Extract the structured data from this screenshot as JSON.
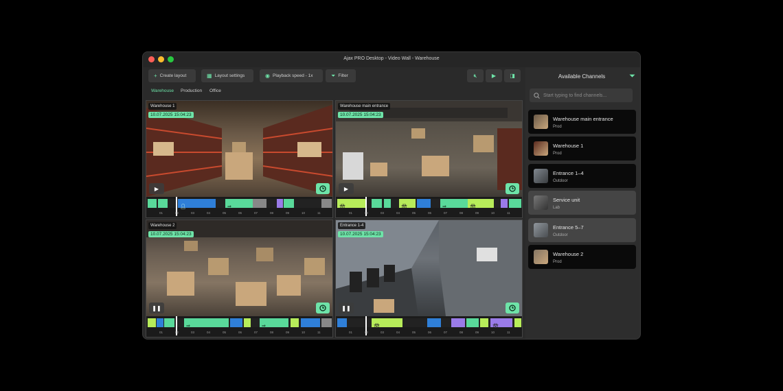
{
  "window": {
    "title": "Ajax PRO Desktop - Video Wall - Warehouse"
  },
  "toolbar": {
    "create_layout": "Create layout",
    "layout_settings": "Layout settings",
    "playback_speed": "Playback speed - 1x",
    "filter": "Filter"
  },
  "tabs": [
    "Warehouse",
    "Production",
    "Office"
  ],
  "cameras": [
    {
      "label": "Warehouse 1",
      "timestamp": "10.07.2025 15:04:23",
      "state": "paused"
    },
    {
      "label": "Warehouse main entrance",
      "timestamp": "10.07.2025 15:04:23",
      "state": "paused"
    },
    {
      "label": "Warehouse 2",
      "timestamp": "10.07.2025 15:04:23",
      "state": "playing"
    },
    {
      "label": "Entrance 1-4",
      "timestamp": "10.07.2025 15:04:23",
      "state": "playing"
    }
  ],
  "timeline_ticks": [
    "01",
    "02",
    "03",
    "04",
    "05",
    "06",
    "07",
    "08",
    "09",
    "10",
    "11"
  ],
  "sidebar": {
    "title": "Available Channels",
    "search_placeholder": "Start typing to find channels...",
    "channels": [
      {
        "name": "Warehouse main entrance",
        "sub": "Prod"
      },
      {
        "name": "Warehouse 1",
        "sub": "Prod"
      },
      {
        "name": "Entrance 1–4",
        "sub": "Outdoor"
      },
      {
        "name": "Service unit",
        "sub": "Lab"
      },
      {
        "name": "Entrance 5–7",
        "sub": "Outdoor"
      },
      {
        "name": "Warehouse 2",
        "sub": "Prod"
      }
    ]
  },
  "colors": {
    "accent": "#6ee3a8",
    "seg_green": "#59d99a",
    "seg_blue": "#2f7fd8",
    "seg_lime": "#b7ec5a",
    "seg_purple": "#9a7be8",
    "seg_gray": "#888888"
  }
}
